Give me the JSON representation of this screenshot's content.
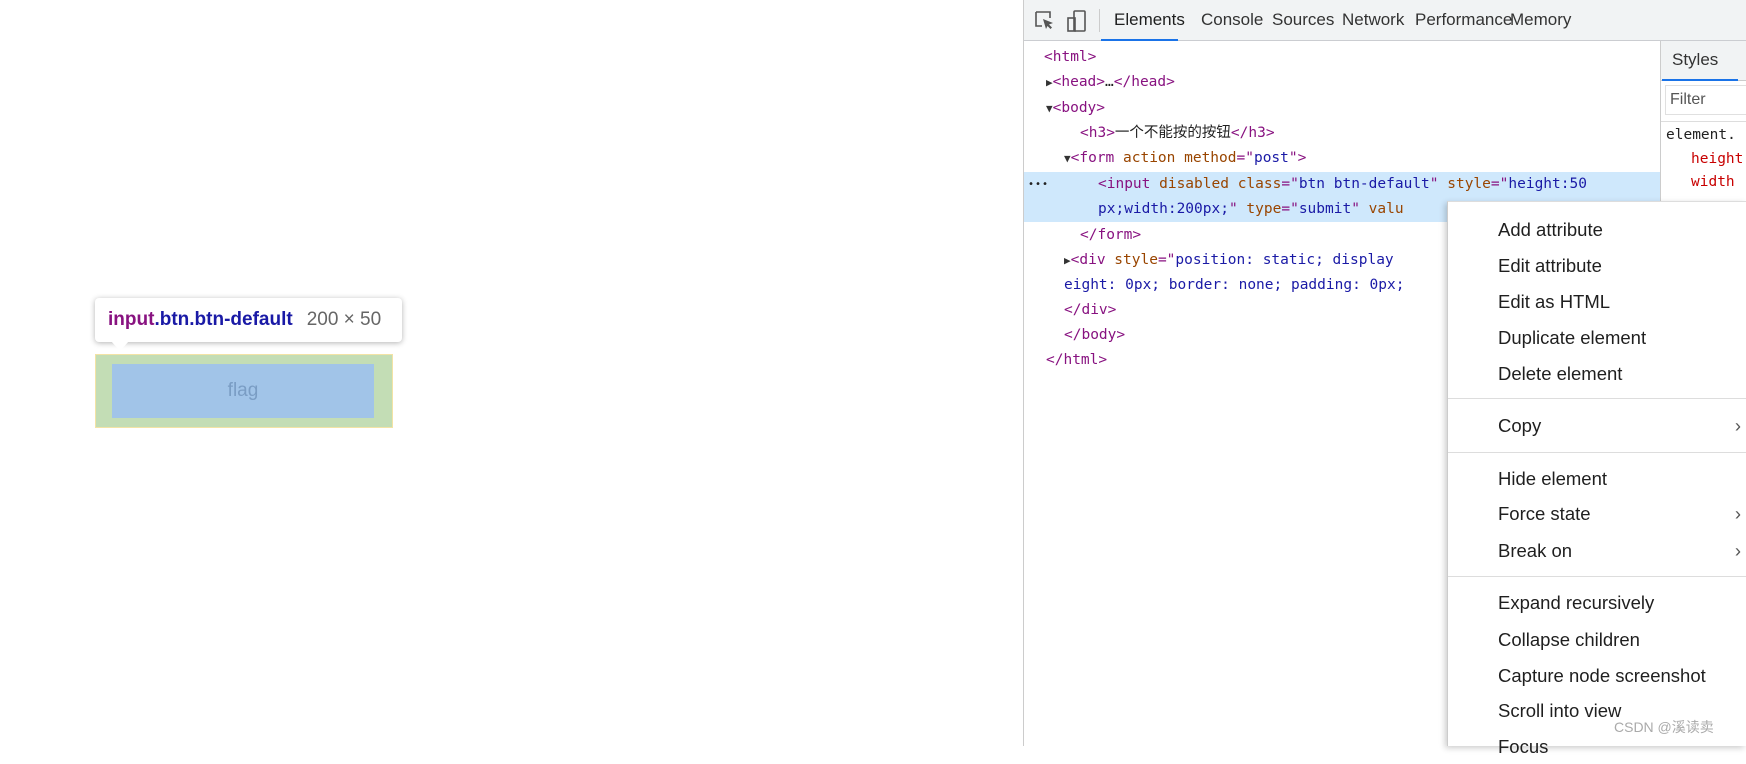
{
  "page": {
    "button_value": "flag"
  },
  "tooltip": {
    "tag": "input",
    "classes": ".btn.btn-default",
    "size": "200 × 50"
  },
  "devtools": {
    "tabs": [
      "Elements",
      "Console",
      "Sources",
      "Network",
      "Performance",
      "Memory"
    ],
    "active_tab": "Elements",
    "styles_tab": "Styles",
    "filter_placeholder": "Filter",
    "styles_rule": "element.",
    "styles_props": [
      "height",
      "width"
    ],
    "dom": {
      "l0": [
        "<html>"
      ],
      "l1": [
        "<head>",
        "…",
        "</head>"
      ],
      "l2": [
        "<body>"
      ],
      "l3": [
        "<h3>",
        "一个不能按的按钮",
        "</h3>"
      ],
      "l4": [
        "<form",
        " action",
        " method",
        "=\"",
        "post",
        "\">"
      ],
      "l5": [
        "<input",
        " disabled",
        " class",
        "=\"",
        "btn btn-default",
        "\"",
        " style",
        "=\"",
        "height:50"
      ],
      "l6": [
        "px;width:200px;",
        "\"",
        " type",
        "=\"",
        "submit",
        "\"",
        " valu"
      ],
      "l7": [
        "</form>"
      ],
      "l8": [
        "<div",
        " style",
        "=\"",
        "position: static; display"
      ],
      "l9": [
        "eight: 0px; border: none; padding: 0px;"
      ],
      "l10": [
        "</div>"
      ],
      "l11": [
        "</body>"
      ],
      "l12": [
        "</html>"
      ],
      "dots": "•••"
    }
  },
  "context_menu": {
    "groups": [
      [
        "Add attribute",
        "Edit attribute",
        "Edit as HTML",
        "Duplicate element",
        "Delete element"
      ],
      [
        "Copy"
      ],
      [
        "Hide element",
        "Force state",
        "Break on"
      ],
      [
        "Expand recursively",
        "Collapse children",
        "Capture node screenshot",
        "Scroll into view",
        "Focus"
      ]
    ],
    "submenu_arrow": "›"
  },
  "watermark": "CSDN @溪读卖"
}
